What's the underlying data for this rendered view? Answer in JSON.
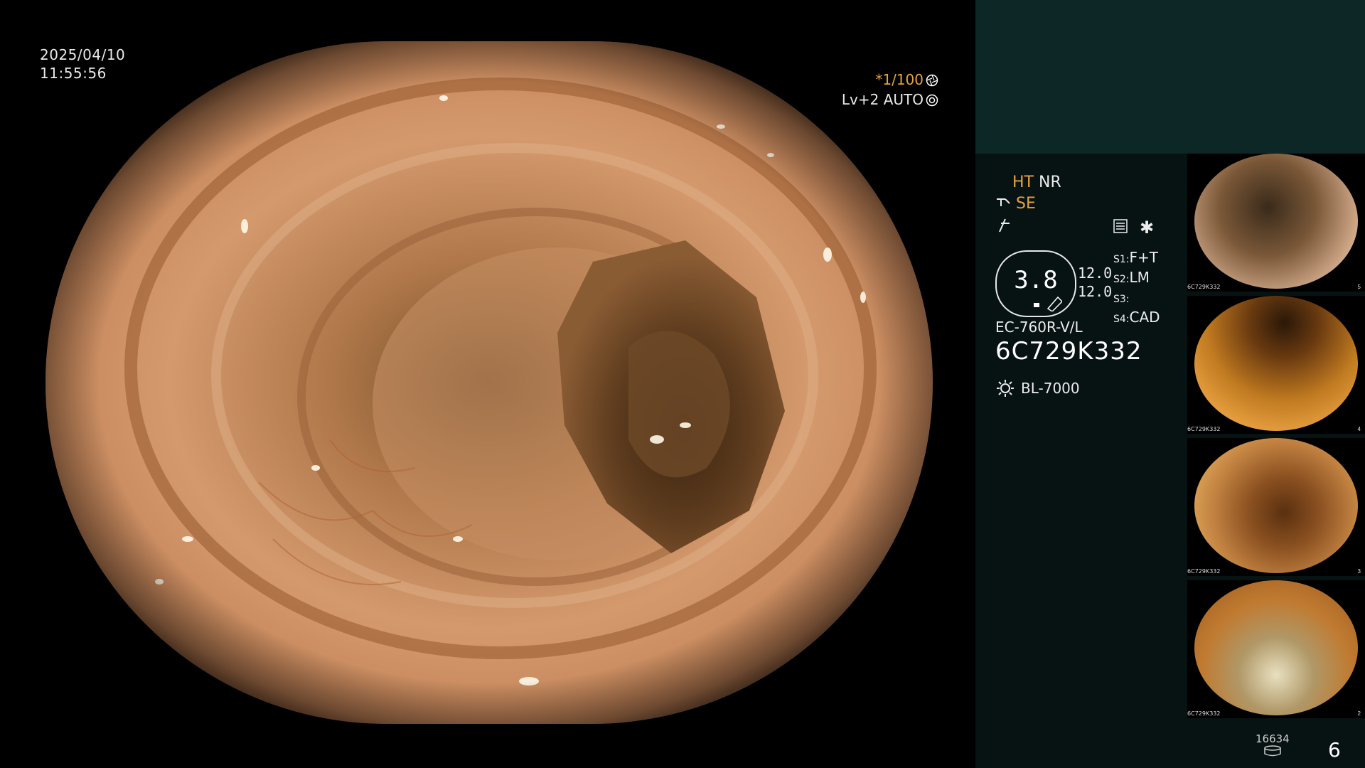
{
  "main_view": {
    "date": "2025/04/10",
    "time": "11:55:56",
    "shutter": "*1/100",
    "level": "Lv+2 AUTO"
  },
  "status": {
    "ht": "HT",
    "nr": "NR",
    "se": "SE",
    "brightness": "3.8",
    "gain_1": "12.0",
    "gain_2": "12.0",
    "s1_label": "S1:",
    "s1_value": "F+T",
    "s2_label": "S2:",
    "s2_value": "LM",
    "s3_label": "S3:",
    "s3_value": "",
    "s4_label": "S4:",
    "s4_value": "CAD",
    "scope_model": "EC-760R-V/L",
    "scope_serial": "6C729K332",
    "light_source": "BL-7000"
  },
  "thumbnails": [
    {
      "serial": "6C729K332",
      "index": "5"
    },
    {
      "serial": "6C729K332",
      "index": "4"
    },
    {
      "serial": "6C729K332",
      "index": "3"
    },
    {
      "serial": "6C729K332",
      "index": "2"
    }
  ],
  "footer": {
    "counter": "16634",
    "page": "6"
  },
  "colors": {
    "accent_orange": "#e8a23a",
    "panel_bg": "#071212",
    "panel_top": "#0d2727"
  }
}
